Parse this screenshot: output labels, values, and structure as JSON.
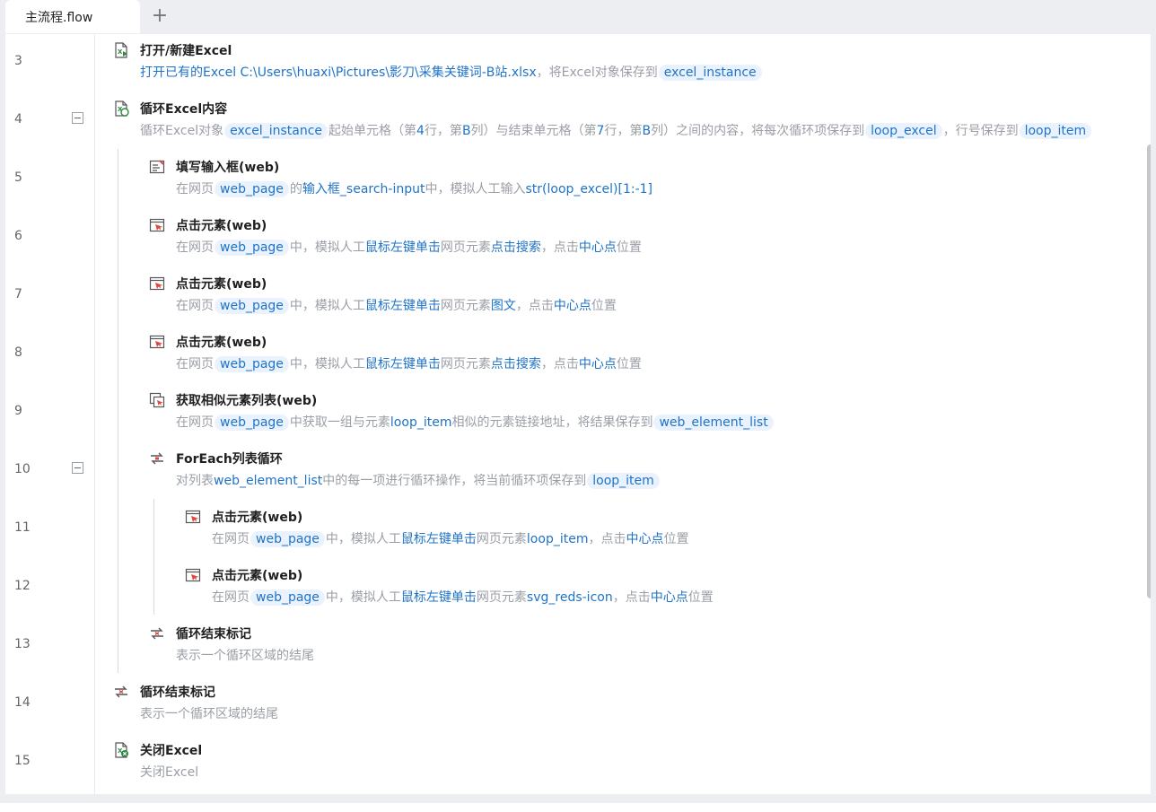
{
  "tabs": {
    "active_label": "主流程.flow",
    "add_label": "+"
  },
  "steps": [
    {
      "line": "3",
      "title": "打开/新建Excel",
      "desc": [
        {
          "t": "b",
          "s": "打开已有的Excel C:\\Users\\huaxi\\Pictures\\影刀\\采集关键词-B站.xlsx"
        },
        {
          "t": "t",
          "s": "，将Excel对象保存到"
        },
        {
          "t": "v",
          "s": "excel_instance"
        }
      ]
    },
    {
      "line": "4",
      "title": "循环Excel内容",
      "desc": [
        {
          "t": "t",
          "s": "循环Excel对象"
        },
        {
          "t": "v",
          "s": "excel_instance"
        },
        {
          "t": "t",
          "s": "起始单元格（第"
        },
        {
          "t": "b",
          "s": "4"
        },
        {
          "t": "t",
          "s": "行，第"
        },
        {
          "t": "b",
          "s": "B"
        },
        {
          "t": "t",
          "s": "列）与结束单元格（第"
        },
        {
          "t": "b",
          "s": "7"
        },
        {
          "t": "t",
          "s": "行，第"
        },
        {
          "t": "b",
          "s": "B"
        },
        {
          "t": "t",
          "s": "列）之间的内容，将每次循环项保存到"
        },
        {
          "t": "v",
          "s": "loop_excel"
        },
        {
          "t": "t",
          "s": "，行号保存到"
        },
        {
          "t": "v",
          "s": "loop_item"
        }
      ]
    },
    {
      "line": "5",
      "title": "填写输入框(web)",
      "desc": [
        {
          "t": "t",
          "s": "在网页"
        },
        {
          "t": "v",
          "s": "web_page"
        },
        {
          "t": "t",
          "s": "的"
        },
        {
          "t": "b",
          "s": "输入框_search-input"
        },
        {
          "t": "t",
          "s": "中，模拟人工输入"
        },
        {
          "t": "b",
          "s": "str(loop_excel)[1:-1]"
        }
      ]
    },
    {
      "line": "6",
      "title": "点击元素(web)",
      "desc": [
        {
          "t": "t",
          "s": "在网页"
        },
        {
          "t": "v",
          "s": "web_page"
        },
        {
          "t": "t",
          "s": "中，模拟人工"
        },
        {
          "t": "b",
          "s": "鼠标左键单击"
        },
        {
          "t": "t",
          "s": "网页元素"
        },
        {
          "t": "b",
          "s": "点击搜索"
        },
        {
          "t": "t",
          "s": "，点击"
        },
        {
          "t": "b",
          "s": "中心点"
        },
        {
          "t": "t",
          "s": "位置"
        }
      ]
    },
    {
      "line": "7",
      "title": "点击元素(web)",
      "desc": [
        {
          "t": "t",
          "s": "在网页"
        },
        {
          "t": "v",
          "s": "web_page"
        },
        {
          "t": "t",
          "s": "中，模拟人工"
        },
        {
          "t": "b",
          "s": "鼠标左键单击"
        },
        {
          "t": "t",
          "s": "网页元素"
        },
        {
          "t": "b",
          "s": "图文"
        },
        {
          "t": "t",
          "s": "，点击"
        },
        {
          "t": "b",
          "s": "中心点"
        },
        {
          "t": "t",
          "s": "位置"
        }
      ]
    },
    {
      "line": "8",
      "title": "点击元素(web)",
      "desc": [
        {
          "t": "t",
          "s": "在网页"
        },
        {
          "t": "v",
          "s": "web_page"
        },
        {
          "t": "t",
          "s": "中，模拟人工"
        },
        {
          "t": "b",
          "s": "鼠标左键单击"
        },
        {
          "t": "t",
          "s": "网页元素"
        },
        {
          "t": "b",
          "s": "点击搜索"
        },
        {
          "t": "t",
          "s": "，点击"
        },
        {
          "t": "b",
          "s": "中心点"
        },
        {
          "t": "t",
          "s": "位置"
        }
      ]
    },
    {
      "line": "9",
      "title": "获取相似元素列表(web)",
      "desc": [
        {
          "t": "t",
          "s": "在网页"
        },
        {
          "t": "v",
          "s": "web_page"
        },
        {
          "t": "t",
          "s": "中获取一组与元素"
        },
        {
          "t": "b",
          "s": "loop_item"
        },
        {
          "t": "t",
          "s": "相似的元素链接地址，将结果保存到"
        },
        {
          "t": "v",
          "s": "web_element_list"
        }
      ]
    },
    {
      "line": "10",
      "title": "ForEach列表循环",
      "desc": [
        {
          "t": "t",
          "s": "对列表"
        },
        {
          "t": "b",
          "s": "web_element_list"
        },
        {
          "t": "t",
          "s": "中的每一项进行循环操作，将当前循环项保存到"
        },
        {
          "t": "v",
          "s": "loop_item"
        }
      ]
    },
    {
      "line": "11",
      "title": "点击元素(web)",
      "desc": [
        {
          "t": "t",
          "s": "在网页"
        },
        {
          "t": "v",
          "s": "web_page"
        },
        {
          "t": "t",
          "s": "中，模拟人工"
        },
        {
          "t": "b",
          "s": "鼠标左键单击"
        },
        {
          "t": "t",
          "s": "网页元素"
        },
        {
          "t": "b",
          "s": "loop_item"
        },
        {
          "t": "t",
          "s": "，点击"
        },
        {
          "t": "b",
          "s": "中心点"
        },
        {
          "t": "t",
          "s": "位置"
        }
      ]
    },
    {
      "line": "12",
      "title": "点击元素(web)",
      "desc": [
        {
          "t": "t",
          "s": "在网页"
        },
        {
          "t": "v",
          "s": "web_page"
        },
        {
          "t": "t",
          "s": "中，模拟人工"
        },
        {
          "t": "b",
          "s": "鼠标左键单击"
        },
        {
          "t": "t",
          "s": "网页元素"
        },
        {
          "t": "b",
          "s": "svg_reds-icon"
        },
        {
          "t": "t",
          "s": "，点击"
        },
        {
          "t": "b",
          "s": "中心点"
        },
        {
          "t": "t",
          "s": "位置"
        }
      ]
    },
    {
      "line": "13",
      "title": "循环结束标记",
      "desc": [
        {
          "t": "t",
          "s": "表示一个循环区域的结尾"
        }
      ]
    },
    {
      "line": "14",
      "title": "循环结束标记",
      "desc": [
        {
          "t": "t",
          "s": "表示一个循环区域的结尾"
        }
      ]
    },
    {
      "line": "15",
      "title": "关闭Excel",
      "desc": [
        {
          "t": "t",
          "s": "关闭Excel"
        }
      ]
    }
  ],
  "icons": [
    "excel-open-icon",
    "excel-loop-icon",
    "fill-input-icon",
    "click-element-icon",
    "click-element-icon",
    "click-element-icon",
    "similar-elements-icon",
    "foreach-loop-icon",
    "click-element-icon",
    "click-element-icon",
    "loop-end-icon",
    "loop-end-icon",
    "excel-close-icon"
  ],
  "colors": {
    "accent": "#1f73c7",
    "variable_bg": "#eaf3fd",
    "muted_text": "#9a9ea6",
    "icon_red": "#e0483e"
  }
}
